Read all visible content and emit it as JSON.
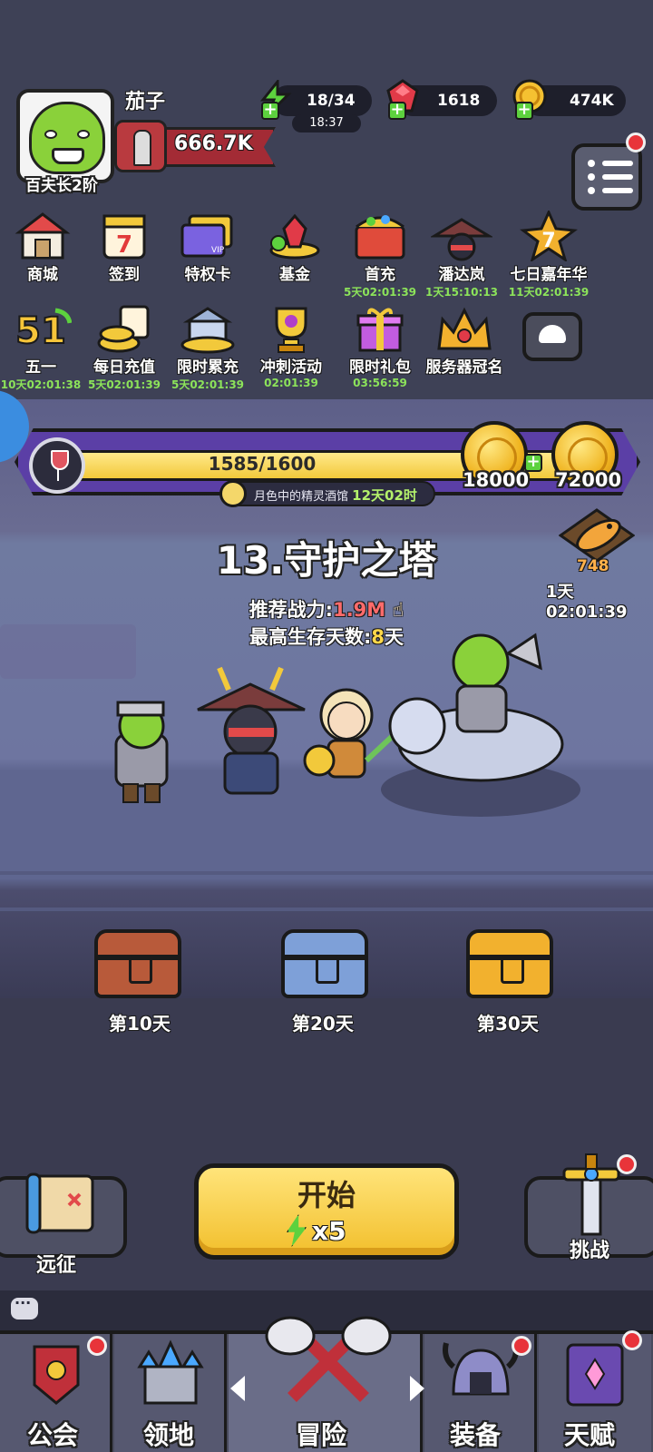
{
  "player": {
    "name": "茄子",
    "rank": "百夫长2阶",
    "power": "666.7K"
  },
  "resources": {
    "stamina": "18/34",
    "stamina_timer": "18:37",
    "gems": "1618",
    "gold": "474K"
  },
  "activities": [
    {
      "label": "商城",
      "timer": ""
    },
    {
      "label": "签到",
      "timer": ""
    },
    {
      "label": "特权卡",
      "timer": ""
    },
    {
      "label": "基金",
      "timer": ""
    },
    {
      "label": "首充",
      "timer": "5天02:01:39"
    },
    {
      "label": "潘达岚",
      "timer": "1天15:10:13"
    },
    {
      "label": "七日嘉年华",
      "timer": "11天02:01:39"
    },
    {
      "label": "五一",
      "timer": "10天02:01:38"
    },
    {
      "label": "每日充值",
      "timer": "5天02:01:39"
    },
    {
      "label": "限时累充",
      "timer": "5天02:01:39"
    },
    {
      "label": "冲刺活动",
      "timer": "02:01:39"
    },
    {
      "label": "限时礼包",
      "timer": "03:56:59"
    },
    {
      "label": "服务器冠名",
      "timer": ""
    }
  ],
  "event_bar": {
    "progress_text": "1585/1600",
    "progress_fraction": 0.99,
    "reward_1": "18000",
    "reward_2": "72000",
    "event_name": "月色中的精灵酒馆",
    "event_time": "12天02时"
  },
  "fish_event": {
    "count": "748",
    "timer": "1天02:01:39"
  },
  "stage": {
    "title": "13.守护之塔",
    "recommended_label": "推荐战力:",
    "recommended_value": "1.9M",
    "best_days_label": "最高生存天数:",
    "best_days_value": "8",
    "best_days_unit": "天"
  },
  "chests": [
    {
      "label": "第10天",
      "color": "#b85a3a"
    },
    {
      "label": "第20天",
      "color": "#7ea0d8"
    },
    {
      "label": "第30天",
      "color": "#f2b12e"
    }
  ],
  "actions": {
    "start_label": "开始",
    "start_cost": "x5",
    "expedition_label": "远征",
    "challenge_label": "挑战"
  },
  "nav": {
    "guild": "公会",
    "territory": "领地",
    "adventure": "冒险",
    "equipment": "装备",
    "talent": "天赋"
  },
  "colors": {
    "accent_green": "#8ce35a",
    "badge_red": "#e8343a",
    "event_purple": "#5b3fa6",
    "gold": "#f2c93b"
  }
}
